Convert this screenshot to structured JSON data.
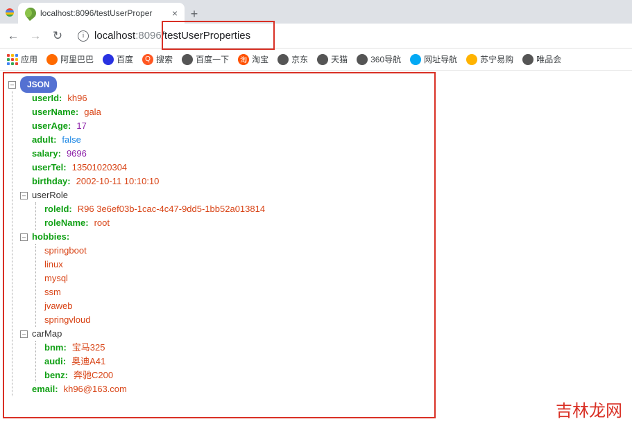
{
  "browser": {
    "tab_title": "localhost:8096/testUserProper",
    "new_tab_glyph": "+",
    "nav": {
      "back": "←",
      "fwd": "→",
      "reload": "↻"
    },
    "url": {
      "info": "i",
      "host": "localhost",
      "port": ":8096",
      "path": "/testUserProperties"
    }
  },
  "bookmarks": {
    "apps": "应用",
    "items": [
      {
        "label": "阿里巴巴",
        "bg": "#ff6a00"
      },
      {
        "label": "百度",
        "bg": "#2932e1"
      },
      {
        "label": "搜索",
        "bg": "#ff5722",
        "text_icon": "Q"
      },
      {
        "label": "百度一下",
        "bg": "#555"
      },
      {
        "label": "淘宝",
        "bg": "#ff5000",
        "text_icon": "淘"
      },
      {
        "label": "京东",
        "bg": "#555"
      },
      {
        "label": "天猫",
        "bg": "#555"
      },
      {
        "label": "360导航",
        "bg": "#555"
      },
      {
        "label": "网址导航",
        "bg": "#03a9f4"
      },
      {
        "label": "苏宁易购",
        "bg": "#ffb300"
      },
      {
        "label": "唯品会",
        "bg": "#555"
      }
    ]
  },
  "json_label": "JSON",
  "json_data": {
    "fields": [
      {
        "k": "userId",
        "v": "kh96",
        "t": "str"
      },
      {
        "k": "userName",
        "v": "gala",
        "t": "str"
      },
      {
        "k": "userAge",
        "v": "17",
        "t": "num"
      },
      {
        "k": "adult",
        "v": "false",
        "t": "bool"
      },
      {
        "k": "salary",
        "v": "9696",
        "t": "num"
      },
      {
        "k": "userTel",
        "v": "13501020304",
        "t": "str"
      },
      {
        "k": "birthday",
        "v": "2002-10-11 10:10:10",
        "t": "str"
      }
    ],
    "userRole": {
      "label": "userRole",
      "fields": [
        {
          "k": "roleId",
          "v": "R96 3e6ef03b-1cac-4c47-9dd5-1bb52a013814",
          "t": "str"
        },
        {
          "k": "roleName",
          "v": "root",
          "t": "str"
        }
      ]
    },
    "hobbies": {
      "label": "hobbies",
      "items": [
        "springboot",
        "linux",
        "mysql",
        "ssm",
        "jvaweb",
        "springvloud"
      ]
    },
    "carMap": {
      "label": "carMap",
      "fields": [
        {
          "k": "bnm",
          "v": "宝马325",
          "t": "str"
        },
        {
          "k": "audi",
          "v": "奥迪A41",
          "t": "str"
        },
        {
          "k": "benz",
          "v": "奔驰C200",
          "t": "str"
        }
      ]
    },
    "email": {
      "k": "email",
      "v": "kh96@163.com",
      "t": "str"
    }
  },
  "watermark": "吉林龙网"
}
